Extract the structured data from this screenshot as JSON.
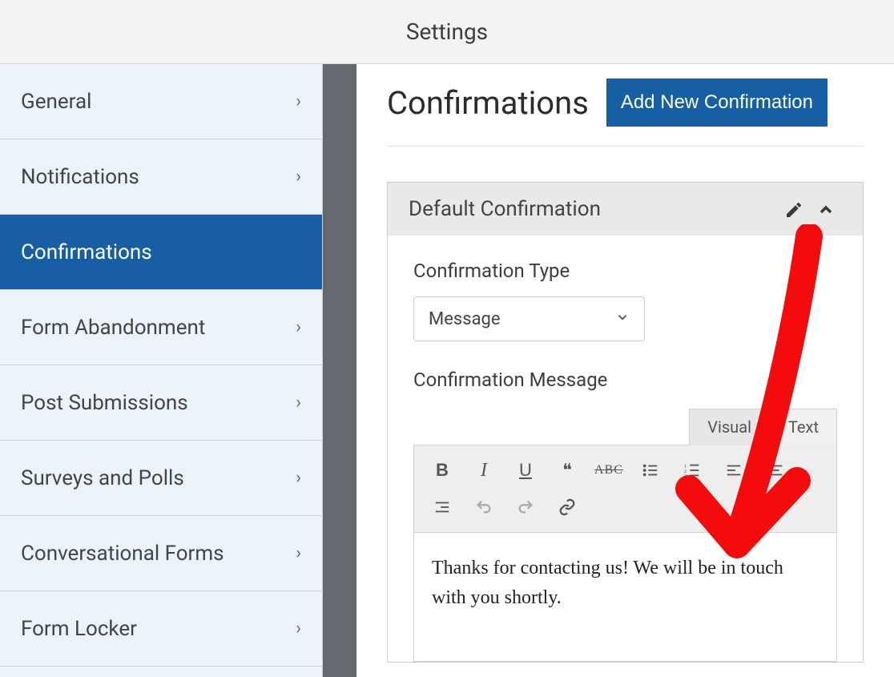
{
  "header": {
    "title": "Settings"
  },
  "sidebar": {
    "items": [
      {
        "label": "General",
        "active": false
      },
      {
        "label": "Notifications",
        "active": false
      },
      {
        "label": "Confirmations",
        "active": true
      },
      {
        "label": "Form Abandonment",
        "active": false
      },
      {
        "label": "Post Submissions",
        "active": false
      },
      {
        "label": "Surveys and Polls",
        "active": false
      },
      {
        "label": "Conversational Forms",
        "active": false
      },
      {
        "label": "Form Locker",
        "active": false
      }
    ]
  },
  "main": {
    "title": "Confirmations",
    "add_button": "Add New Confirmation",
    "panel": {
      "title": "Default Confirmation",
      "type_label": "Confirmation Type",
      "type_value": "Message",
      "message_label": "Confirmation Message",
      "editor_tabs": {
        "visual": "Visual",
        "text": "Text"
      },
      "toolbar": {
        "bold": "B",
        "italic": "I",
        "underline": "U",
        "quote": "❝",
        "strike": "ABC"
      },
      "content": "Thanks for contacting us! We will be in touch with you shortly."
    }
  }
}
